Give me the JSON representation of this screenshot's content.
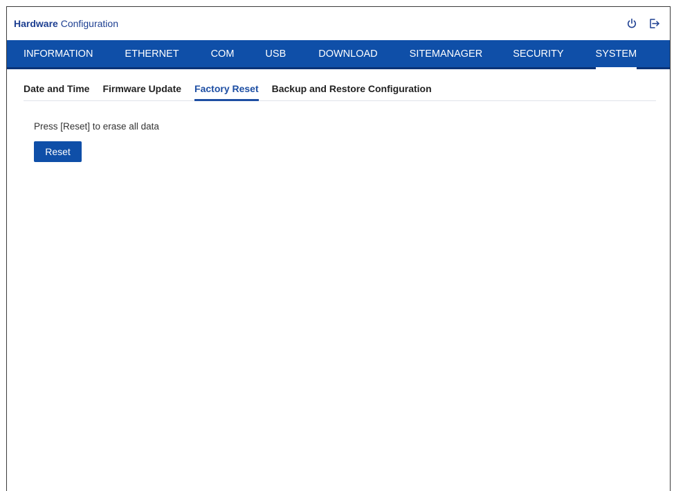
{
  "header": {
    "title_bold": "Hardware",
    "title_rest": "Configuration",
    "icons": [
      "power-icon",
      "logout-icon"
    ]
  },
  "main_nav": {
    "items": [
      {
        "label": "INFORMATION"
      },
      {
        "label": "ETHERNET"
      },
      {
        "label": "COM"
      },
      {
        "label": "USB"
      },
      {
        "label": "DOWNLOAD"
      },
      {
        "label": "SITEMANAGER"
      },
      {
        "label": "SECURITY"
      },
      {
        "label": "SYSTEM",
        "active": true
      }
    ]
  },
  "sub_tabs": {
    "items": [
      {
        "label": "Date and Time"
      },
      {
        "label": "Firmware Update"
      },
      {
        "label": "Factory Reset",
        "active": true
      },
      {
        "label": "Backup and Restore Configuration"
      }
    ]
  },
  "factory_reset": {
    "instruction": "Press [Reset] to erase all data",
    "button_label": "Reset"
  },
  "colors": {
    "brand_blue": "#0f4fa8",
    "title_blue": "#1d3f91"
  }
}
